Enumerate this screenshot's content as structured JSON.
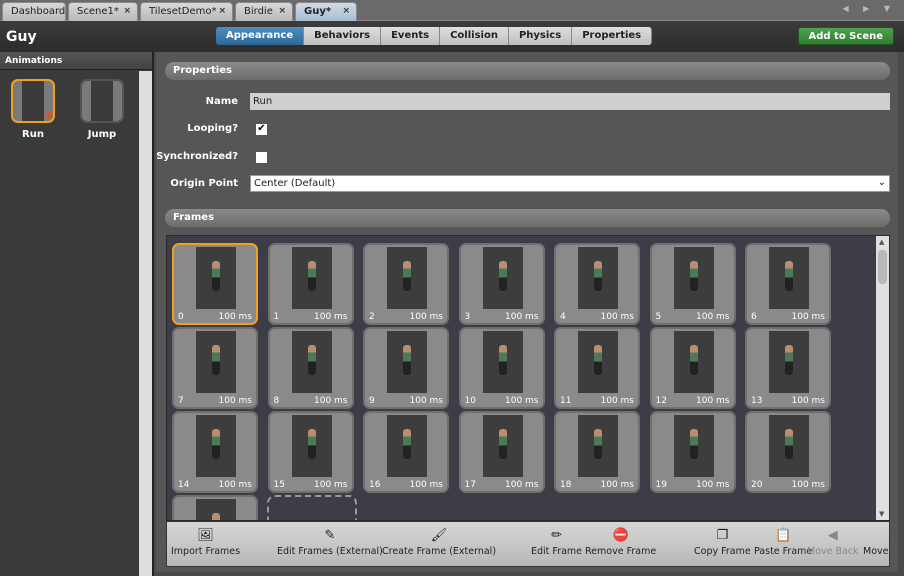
{
  "tabs": [
    {
      "label": "Dashboard",
      "closable": false
    },
    {
      "label": "Scene1*",
      "closable": true
    },
    {
      "label": "TilesetDemo*",
      "closable": true
    },
    {
      "label": "Birdie",
      "closable": true
    },
    {
      "label": "Guy*",
      "closable": true,
      "active": true
    }
  ],
  "header": {
    "title": "Guy",
    "segments": [
      "Appearance",
      "Behaviors",
      "Events",
      "Collision",
      "Physics",
      "Properties"
    ],
    "active_segment": "Appearance",
    "add_button": "Add to Scene"
  },
  "animations": {
    "title": "Animations",
    "items": [
      {
        "label": "Run",
        "selected": true,
        "default": true
      },
      {
        "label": "Jump"
      }
    ]
  },
  "properties": {
    "title": "Properties",
    "name_label": "Name",
    "name_value": "Run",
    "looping_label": "Looping?",
    "looping": true,
    "synchronized_label": "Synchronized?",
    "synchronized": false,
    "origin_label": "Origin Point",
    "origin_value": "Center (Default)"
  },
  "frames": {
    "title": "Frames",
    "selected": 0,
    "items": [
      {
        "n": "0",
        "d": "100 ms"
      },
      {
        "n": "1",
        "d": "100 ms"
      },
      {
        "n": "2",
        "d": "100 ms"
      },
      {
        "n": "3",
        "d": "100 ms"
      },
      {
        "n": "4",
        "d": "100 ms"
      },
      {
        "n": "5",
        "d": "100 ms"
      },
      {
        "n": "6",
        "d": "100 ms"
      },
      {
        "n": "7",
        "d": "100 ms"
      },
      {
        "n": "8",
        "d": "100 ms"
      },
      {
        "n": "9",
        "d": "100 ms"
      },
      {
        "n": "10",
        "d": "100 ms"
      },
      {
        "n": "11",
        "d": "100 ms"
      },
      {
        "n": "12",
        "d": "100 ms"
      },
      {
        "n": "13",
        "d": "100 ms"
      },
      {
        "n": "14",
        "d": "100 ms"
      },
      {
        "n": "15",
        "d": "100 ms"
      },
      {
        "n": "16",
        "d": "100 ms"
      },
      {
        "n": "17",
        "d": "100 ms"
      },
      {
        "n": "18",
        "d": "100 ms"
      },
      {
        "n": "19",
        "d": "100 ms"
      },
      {
        "n": "20",
        "d": "100 ms"
      },
      {
        "n": "",
        "d": ""
      }
    ]
  },
  "toolbar": [
    {
      "label": "Import Frames",
      "icon": "🖼"
    },
    {
      "label": "Edit Frames (External)",
      "icon": "✎"
    },
    {
      "label": "Create Frame (External)",
      "icon": "🖌"
    },
    {
      "label": "Edit Frame",
      "icon": "✏"
    },
    {
      "label": "Remove Frame",
      "icon": "⛔"
    },
    {
      "label": "Copy Frame",
      "icon": "❐"
    },
    {
      "label": "Paste Frame",
      "icon": "📋"
    },
    {
      "label": "Move Back",
      "icon": "◀",
      "disabled": true
    },
    {
      "label": "Move",
      "icon": ""
    }
  ]
}
